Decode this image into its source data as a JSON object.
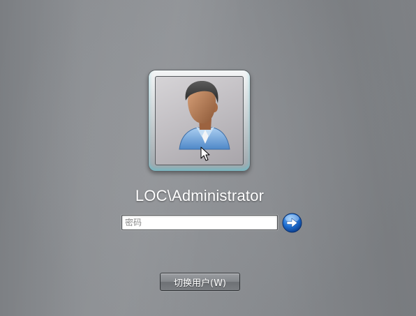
{
  "user": {
    "name": "LOC\\Administrator",
    "avatar": "user-silhouette-icon"
  },
  "password": {
    "placeholder": "密码",
    "value": ""
  },
  "submit": {
    "icon": "arrow-right-icon",
    "color": "#1f6fd1"
  },
  "switch_user": {
    "label": "切换用户(W)"
  },
  "colors": {
    "background": "#8a8d91",
    "tile_glow": "#5ac8d7",
    "text": "#ffffff"
  }
}
